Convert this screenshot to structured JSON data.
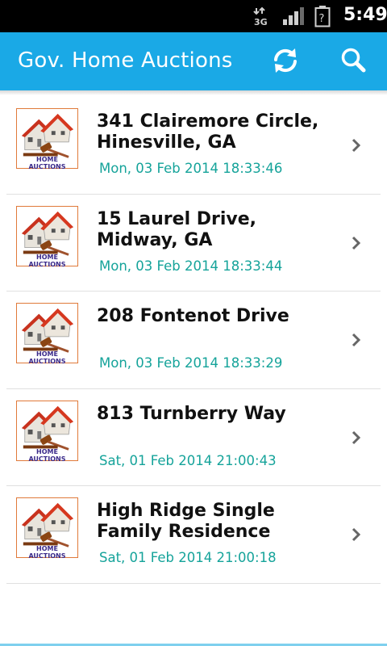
{
  "status_bar": {
    "network_label": "3G",
    "time": "5:49",
    "icons": [
      "network-3g-icon",
      "signal-icon",
      "battery-unknown-icon"
    ]
  },
  "action_bar": {
    "title": "Gov. Home Auctions",
    "accent_color": "#1aa9e6",
    "actions": [
      "refresh-icon",
      "search-icon"
    ]
  },
  "listings": [
    {
      "thumb_label": "HOME AUCTIONS",
      "address": "341 Clairemore Circle, Hinesville, GA",
      "date": "Mon, 03 Feb 2014 18:33:46"
    },
    {
      "thumb_label": "HOME AUCTIONS",
      "address": "15 Laurel Drive, Midway, GA",
      "date": "Mon, 03 Feb 2014 18:33:44"
    },
    {
      "thumb_label": "HOME AUCTIONS",
      "address": "208 Fontenot Drive",
      "date": "Mon, 03 Feb 2014 18:33:29"
    },
    {
      "thumb_label": "HOME AUCTIONS",
      "address": "813 Turnberry Way",
      "date": "Sat, 01 Feb 2014 21:00:43"
    },
    {
      "thumb_label": "HOME AUCTIONS",
      "address": "High Ridge Single Family Residence",
      "date": "Sat, 01 Feb 2014 21:00:18"
    }
  ],
  "colors": {
    "date_text": "#15a39a",
    "address_text": "#111111"
  }
}
